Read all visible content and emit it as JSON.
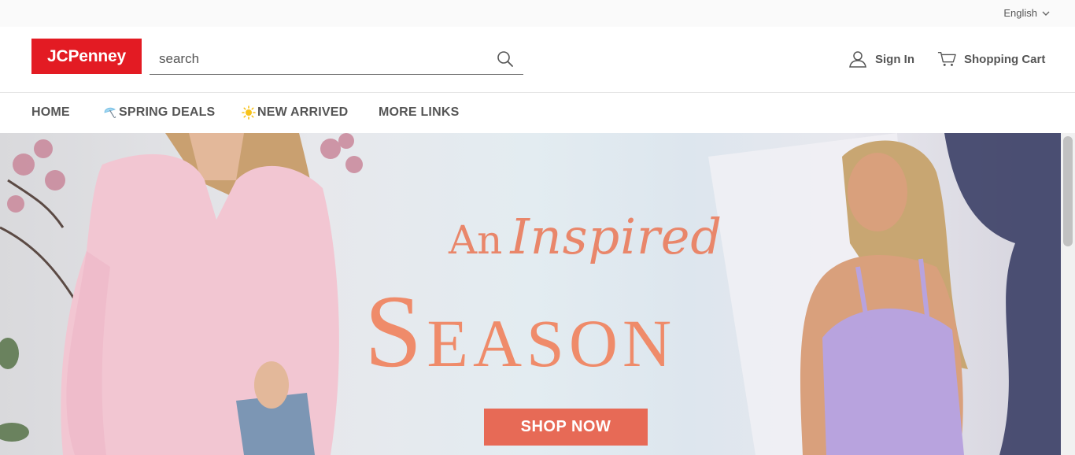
{
  "language": {
    "label": "English",
    "chevron_icon": "chevron-down-icon"
  },
  "header": {
    "logo_text": "JCPenney",
    "search": {
      "placeholder": "search",
      "value": "",
      "icon": "search-icon"
    },
    "sign_in": {
      "label": "Sign In",
      "icon": "user-icon"
    },
    "cart": {
      "label": "Shopping Cart",
      "icon": "cart-icon"
    }
  },
  "nav": {
    "items": [
      {
        "label": "HOME"
      },
      {
        "label": "SPRING DEALS",
        "icon": "umbrella-icon"
      },
      {
        "label": "NEW ARRIVED",
        "icon": "sun-icon"
      },
      {
        "label": "MORE LINKS"
      }
    ]
  },
  "hero": {
    "line1_plain": "An",
    "line1_script": "Inspired",
    "line2_first": "S",
    "line2_rest": "EASON",
    "cta_label": "SHOP NOW"
  },
  "colors": {
    "brand_red": "#e31b23",
    "hero_accent": "#ef8b6a",
    "cta_bg": "#e76a56"
  }
}
